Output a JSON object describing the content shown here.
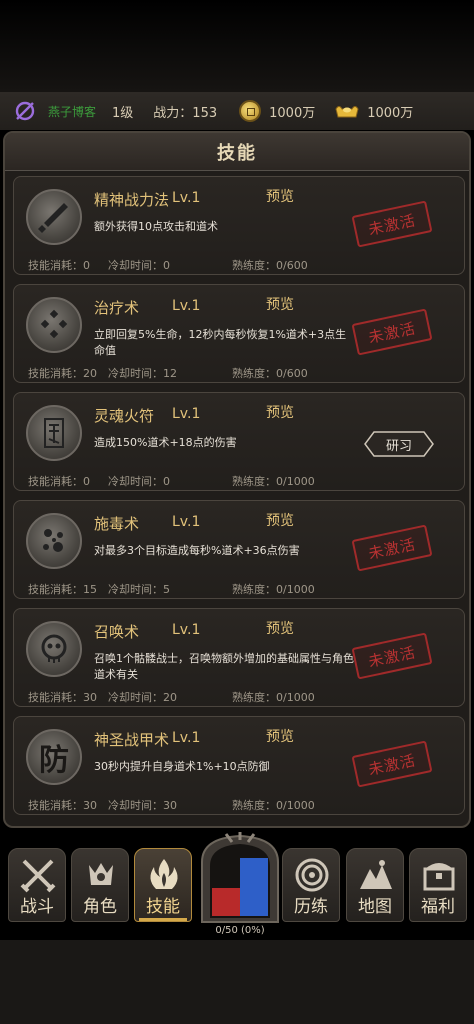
{
  "status": {
    "name": "燕子博客",
    "level": "1级",
    "power": "战力：153",
    "money": "1000万",
    "ingot": "1000万"
  },
  "panel": {
    "title": "技能"
  },
  "skills": [
    {
      "name": "精神战力法",
      "level": "Lv.1",
      "preview": "预览",
      "desc": "额外获得10点攻击和道术",
      "cost": "技能消耗：0",
      "cooldown": "冷却时间：0",
      "proficiency": "熟练度：0/600",
      "status": "未激活",
      "icon": "spirit-sword-icon"
    },
    {
      "name": "治疗术",
      "level": "Lv.1",
      "preview": "预览",
      "desc": "立即回复5%生命，12秒内每秒恢复1%道术+3点生命值",
      "cost": "技能消耗：20",
      "cooldown": "冷却时间：12",
      "proficiency": "熟练度：0/600",
      "status": "未激活",
      "icon": "healing-icon"
    },
    {
      "name": "灵魂火符",
      "level": "Lv.1",
      "preview": "预览",
      "desc": "造成150%道术+18点的伤害",
      "cost": "技能消耗：0",
      "cooldown": "冷却时间：0",
      "proficiency": "熟练度：0/1000",
      "status": "研习",
      "icon": "talisman-icon"
    },
    {
      "name": "施毒术",
      "level": "Lv.1",
      "preview": "预览",
      "desc": "对最多3个目标造成每秒%道术+36点伤害",
      "cost": "技能消耗：15",
      "cooldown": "冷却时间：5",
      "proficiency": "熟练度：0/1000",
      "status": "未激活",
      "icon": "poison-icon"
    },
    {
      "name": "召唤术",
      "level": "Lv.1",
      "preview": "预览",
      "desc": "召唤1个骷髅战士，召唤物额外增加的基础属性与角色道术有关",
      "cost": "技能消耗：30",
      "cooldown": "冷却时间：20",
      "proficiency": "熟练度：0/1000",
      "status": "未激活",
      "icon": "skull-icon"
    },
    {
      "name": "神圣战甲术",
      "level": "Lv.1",
      "preview": "预览",
      "desc": "30秒内提升自身道术1%+10点防御",
      "cost": "技能消耗：30",
      "cooldown": "冷却时间：30",
      "proficiency": "熟练度：0/1000",
      "status": "未激活",
      "icon": "armor-icon",
      "icon_char": "防"
    }
  ],
  "nav": {
    "items": [
      {
        "label": "战斗"
      },
      {
        "label": "角色"
      },
      {
        "label": "技能"
      },
      {
        "label": "历练"
      },
      {
        "label": "地图"
      },
      {
        "label": "福利"
      }
    ],
    "portal_progress": "0/50 (0%)",
    "portal_fill": 0
  },
  "colors": {
    "accent": "#e2c27a",
    "stamp": "#b83232",
    "name": "#3c9c3c"
  }
}
